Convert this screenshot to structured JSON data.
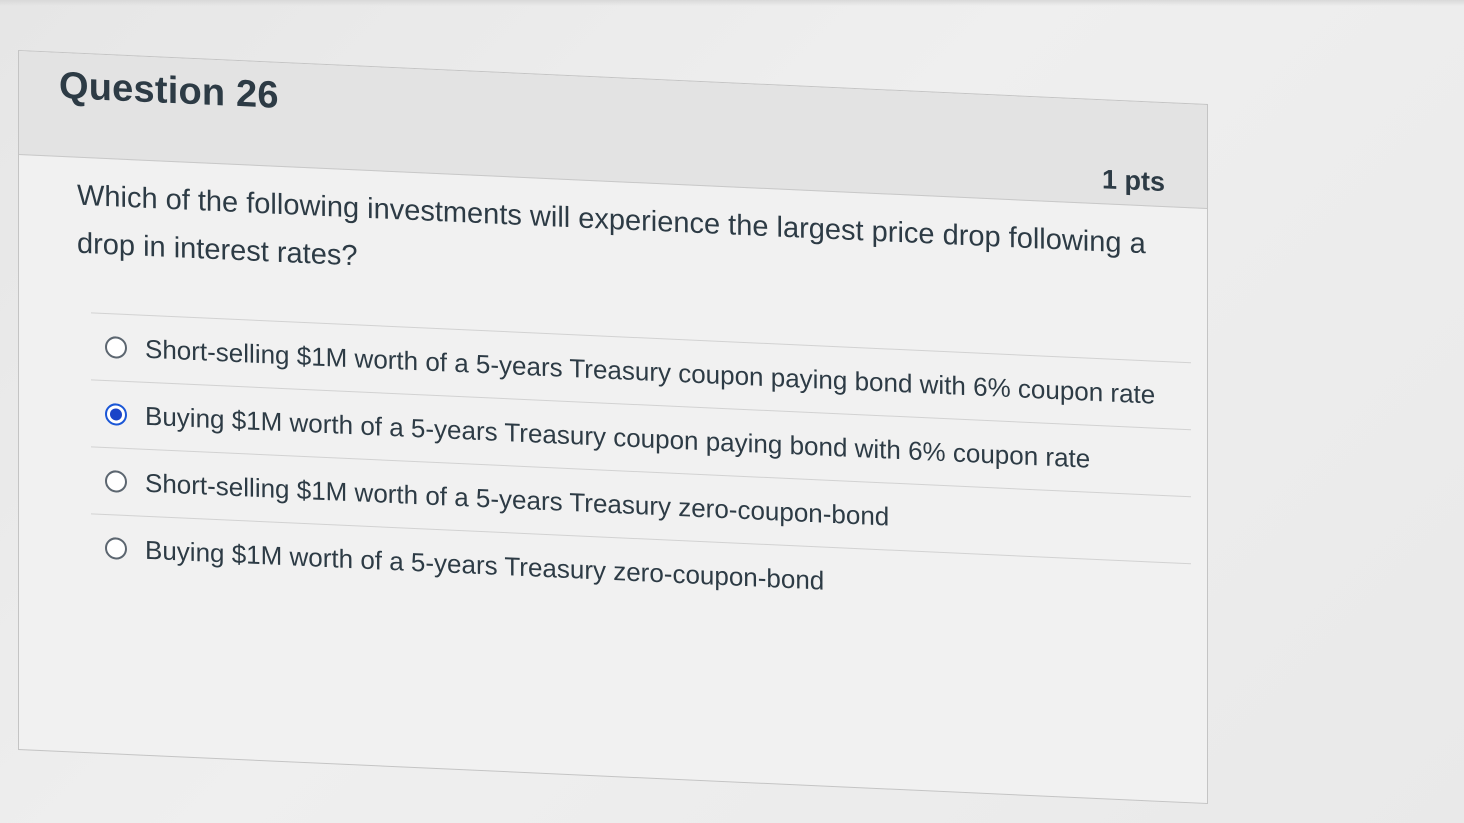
{
  "question": {
    "title": "Question 26",
    "points": "1 pts",
    "text": "Which of the following investments will experience the largest price drop following a drop in interest rates?",
    "answers": [
      {
        "label": "Short-selling $1M worth of a 5-years Treasury coupon paying bond with 6% coupon rate",
        "selected": false
      },
      {
        "label": "Buying $1M worth of a 5-years Treasury coupon paying bond with 6% coupon rate",
        "selected": true
      },
      {
        "label": "Short-selling $1M worth of a 5-years Treasury zero-coupon-bond",
        "selected": false
      },
      {
        "label": "Buying $1M worth of a 5-years Treasury zero-coupon-bond",
        "selected": false
      }
    ]
  },
  "colors": {
    "text": "#2d3b45",
    "selected_radio": "#1a44c8",
    "header_bg": "#e3e3e3"
  },
  "icons": {
    "radio_unchecked": "radio-unchecked-icon",
    "radio_checked": "radio-checked-icon"
  }
}
